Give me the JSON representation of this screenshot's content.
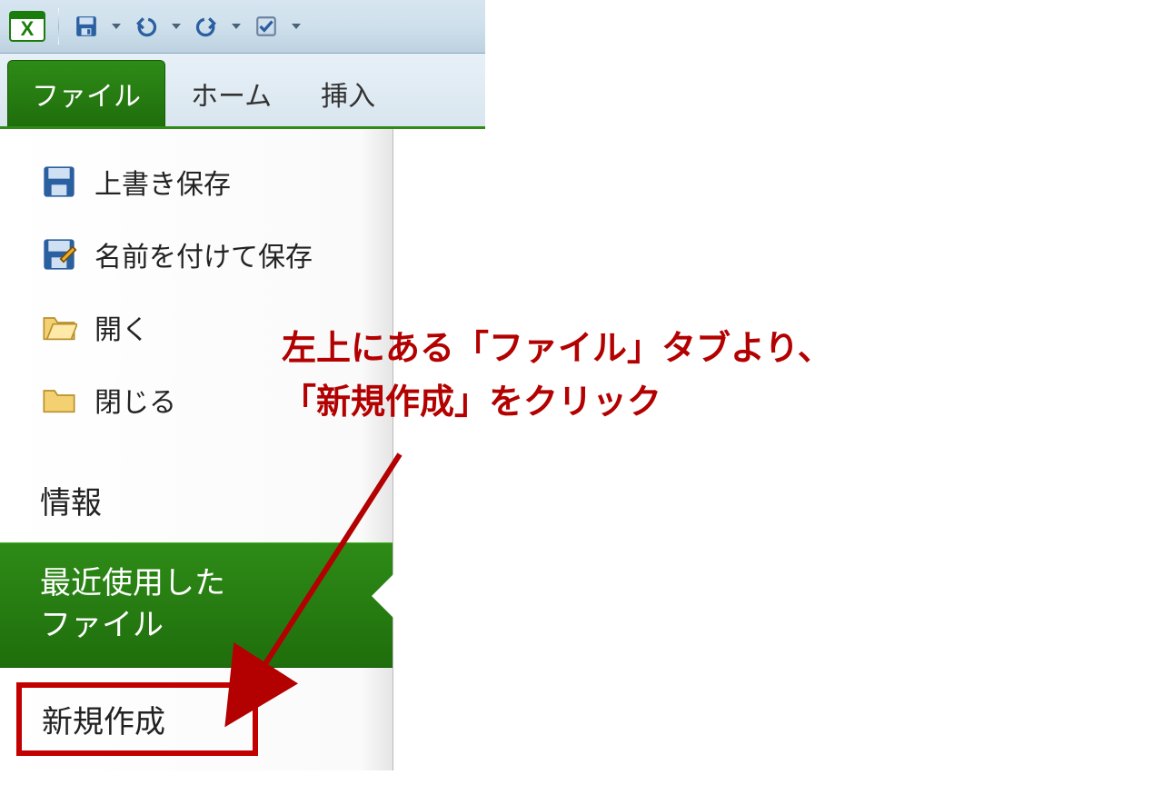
{
  "quick_access": {
    "save_label": "save",
    "undo_label": "undo",
    "redo_label": "redo",
    "check_label": "check"
  },
  "ribbon": {
    "file": "ファイル",
    "home": "ホーム",
    "insert": "挿入"
  },
  "backstage": {
    "save": "上書き保存",
    "save_as": "名前を付けて保存",
    "open": "開く",
    "close": "閉じる",
    "info": "情報",
    "recent_line1": "最近使用した",
    "recent_line2": "ファイル",
    "new": "新規作成"
  },
  "annotation": {
    "line1": "左上にある「ファイル」タブより、",
    "line2": "「新規作成」をクリック"
  },
  "colors": {
    "accent_red": "#b30000",
    "brand_green": "#2e8b17"
  }
}
